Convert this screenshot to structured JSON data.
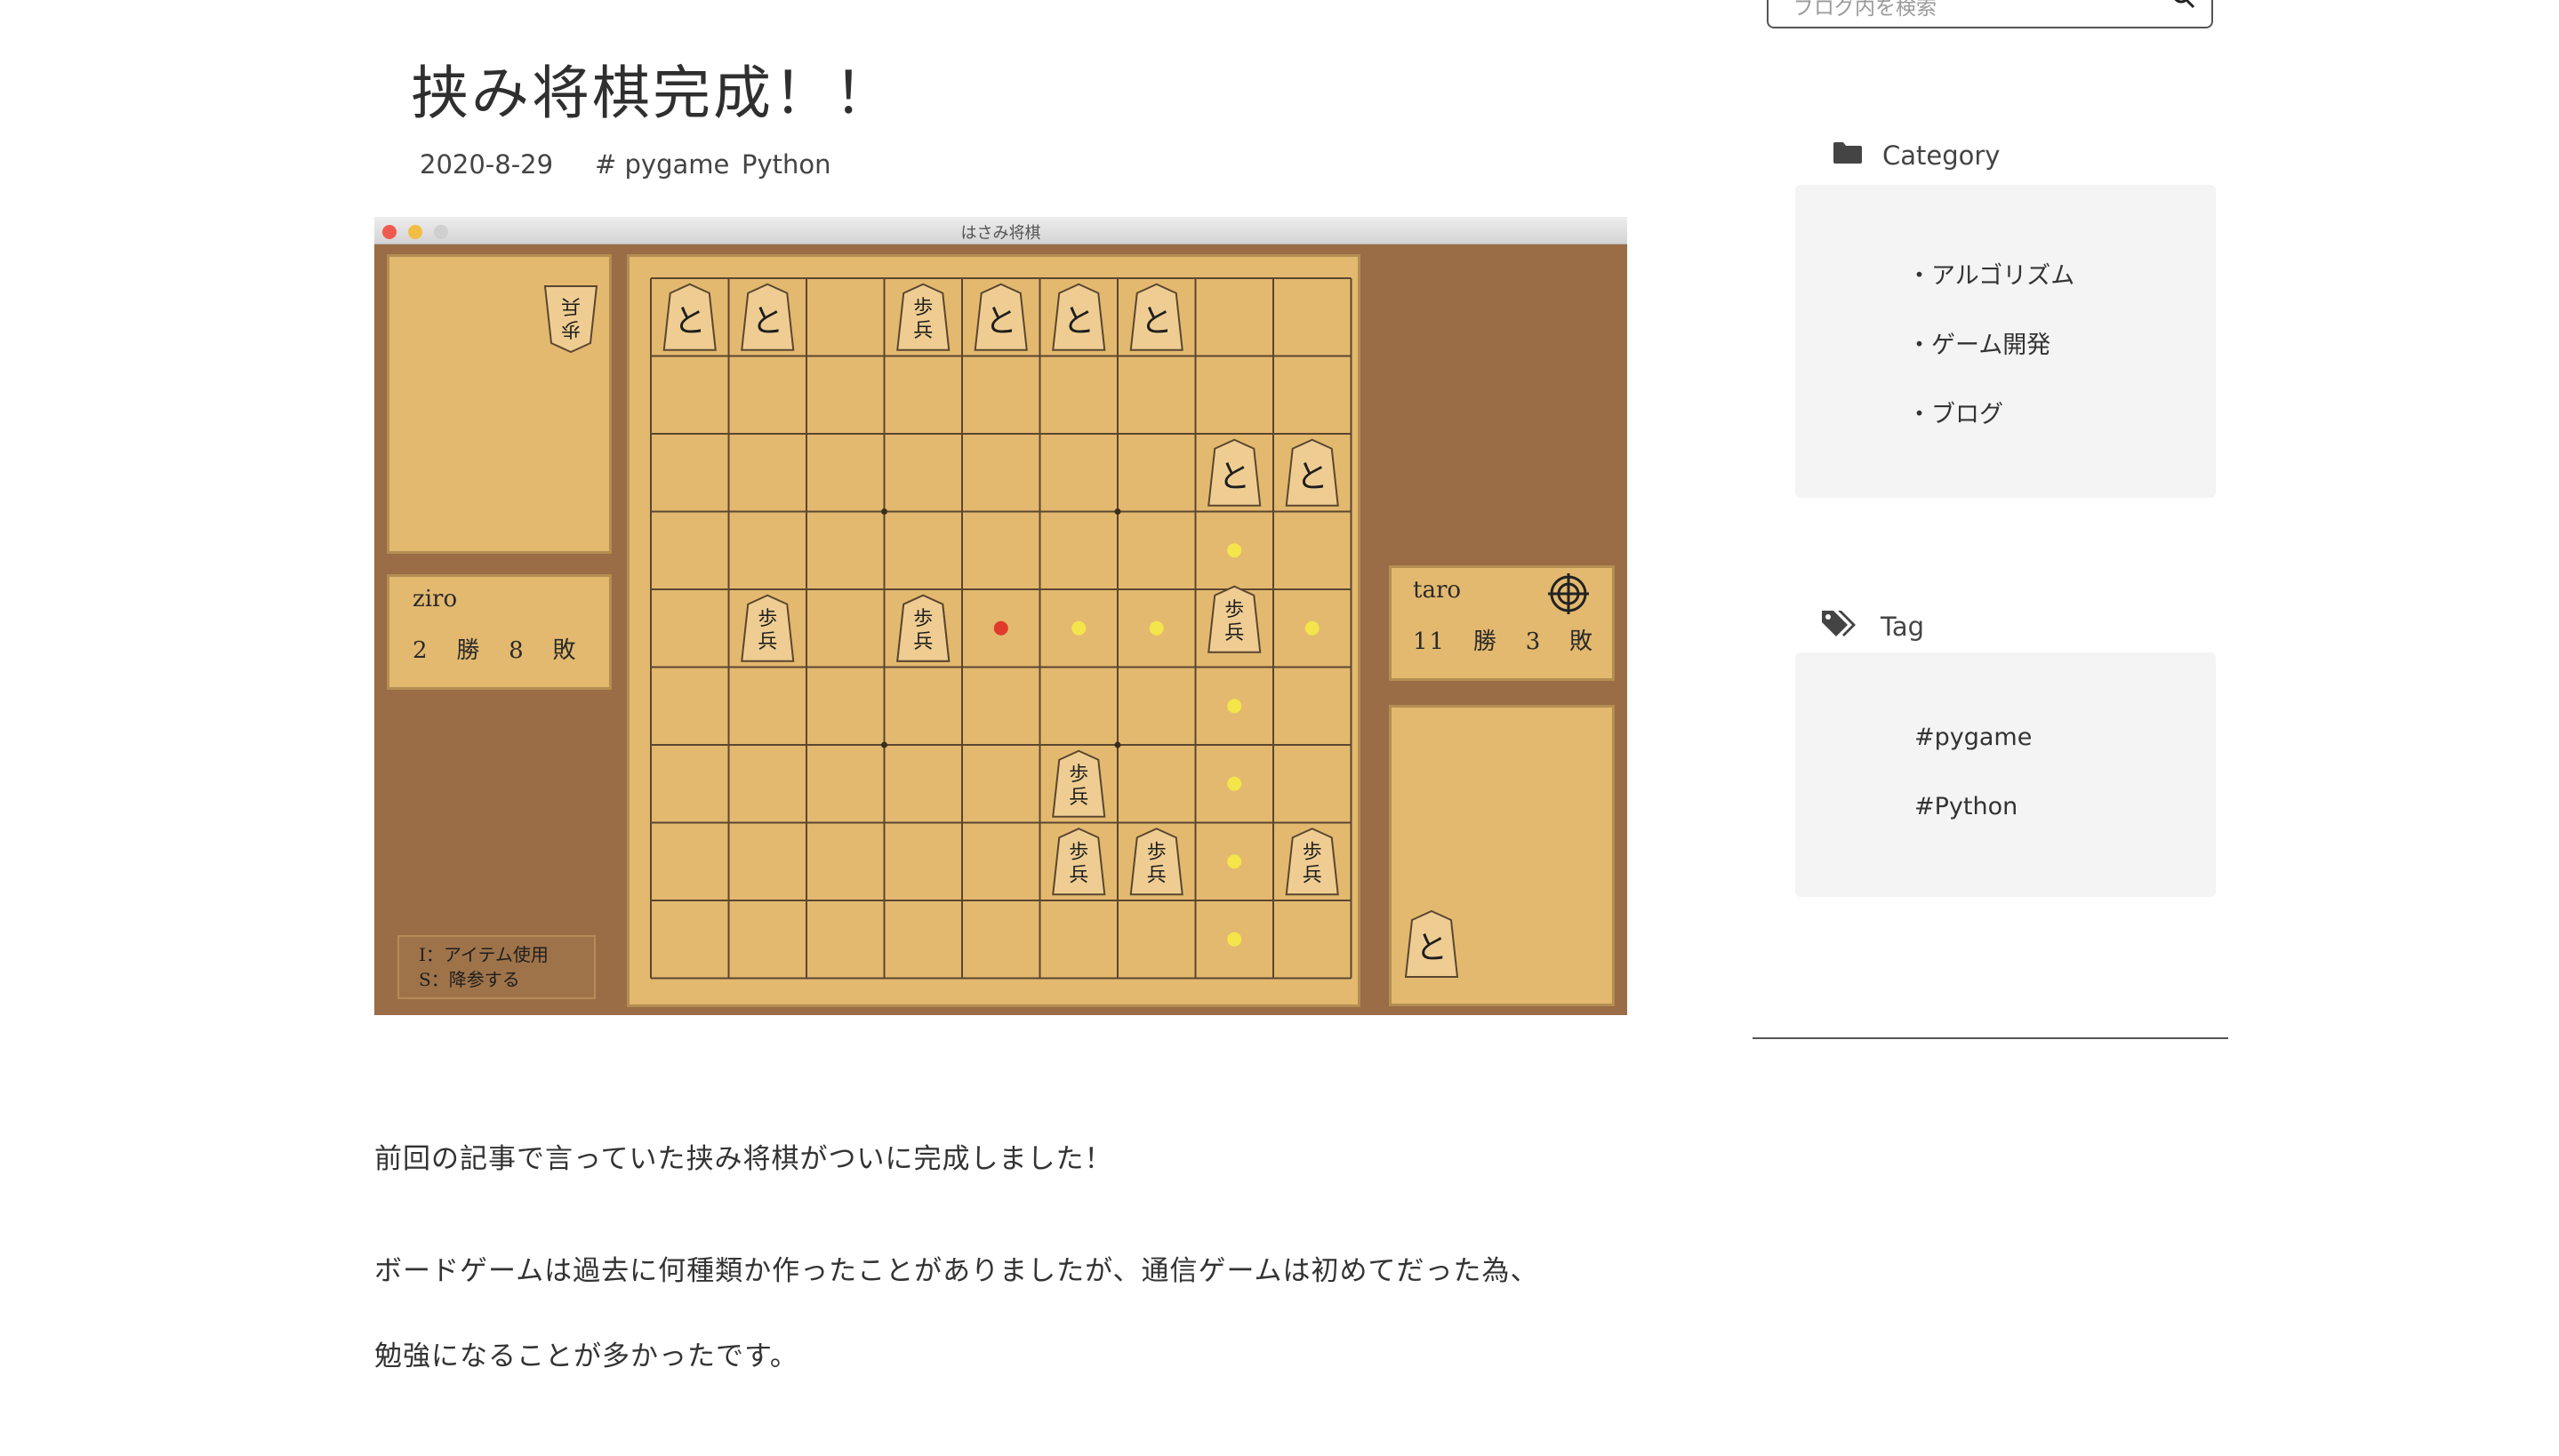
{
  "search": {
    "placeholder": "ブログ内を検索"
  },
  "article": {
    "title": "挟み将棋完成！！",
    "date": "2020-8-29",
    "tags": [
      "# pygame",
      "Python"
    ],
    "paragraphs": [
      "前回の記事で言っていた挟み将棋がついに完成しました！",
      "ボードゲームは過去に何種類か作ったことがありましたが、通信ゲームは初めてだった為、",
      "勉強になることが多かったです。"
    ]
  },
  "game": {
    "window_title": "はさみ将棋",
    "player_left": {
      "name": "ziro",
      "wins": "2",
      "win_label": "勝",
      "losses": "8",
      "loss_label": "敗"
    },
    "player_right": {
      "name": "taro",
      "wins": "11",
      "win_label": "勝",
      "losses": "3",
      "loss_label": "敗"
    },
    "help_lines": [
      "I：アイテム使用",
      "S：降参する"
    ],
    "board": {
      "size": 9,
      "black_pieces": [
        [
          4,
          1
        ],
        [
          2,
          5
        ],
        [
          4,
          5
        ],
        [
          6,
          7
        ],
        [
          6,
          8
        ],
        [
          7,
          8
        ],
        [
          9,
          8
        ]
      ],
      "white_pieces": [
        [
          1,
          1
        ],
        [
          2,
          1
        ],
        [
          5,
          1
        ],
        [
          6,
          1
        ],
        [
          7,
          1
        ],
        [
          8,
          3
        ],
        [
          9,
          3
        ],
        [
          4,
          5
        ]
      ],
      "selected_piece": [
        8,
        5
      ],
      "red_dot": [
        5,
        5
      ],
      "move_dots": [
        [
          8,
          4
        ],
        [
          6,
          5
        ],
        [
          7,
          5
        ],
        [
          9,
          5
        ],
        [
          8,
          6
        ],
        [
          8,
          7
        ],
        [
          8,
          8
        ],
        [
          8,
          9
        ]
      ],
      "star_points": [
        [
          3,
          3
        ],
        [
          6,
          3
        ],
        [
          3,
          6
        ],
        [
          6,
          6
        ]
      ],
      "piece_labels": {
        "black": [
          "歩",
          "兵"
        ],
        "white": [
          "と"
        ]
      },
      "captured_top": "歩兵",
      "captured_bottom": "と"
    },
    "colors": {
      "board": "#e3b96f",
      "frame": "#9a6d46",
      "move_dot": "#f3e54a",
      "red_dot": "#e03a2a"
    }
  },
  "sidebar": {
    "category_heading": "Category",
    "categories": [
      "・アルゴリズム",
      "・ゲーム開発",
      "・ブログ"
    ],
    "tag_heading": "Tag",
    "tags": [
      "#pygame",
      "#Python"
    ],
    "icons": {
      "search": "search-icon",
      "category": "folder-icon",
      "tag": "tags-icon"
    }
  }
}
